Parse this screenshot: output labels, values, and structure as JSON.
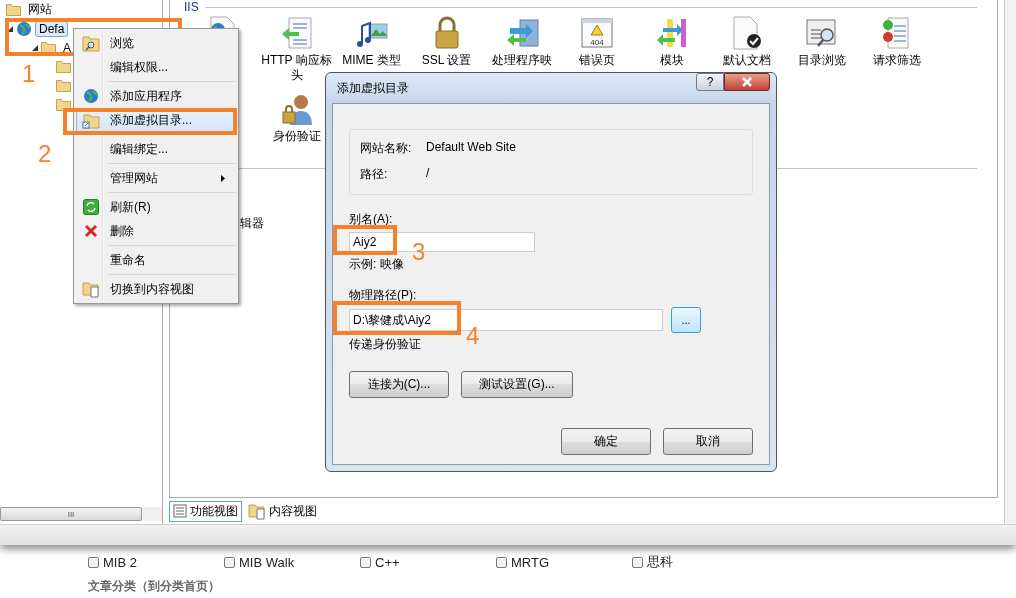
{
  "tree": {
    "root": {
      "kind": "folder",
      "label": "网站",
      "children": [
        {
          "kind": "globe",
          "label": "Defa",
          "selected": true,
          "expanded": true,
          "children": [
            {
              "kind": "folder",
              "label": "A",
              "expanded": true,
              "children": [
                {
                  "kind": "folder"
                },
                {
                  "kind": "folder"
                },
                {
                  "kind": "folder"
                }
              ]
            }
          ]
        }
      ]
    },
    "scrollbar_grip": "III"
  },
  "section_title": "IIS",
  "feature_rows": [
    {
      "items": [
        {
          "kind": "globe"
        },
        {
          "kind": "http",
          "label": "HTTP 响应标头"
        },
        {
          "kind": "mime",
          "label": "MIME 类型"
        },
        {
          "kind": "lock",
          "label": "SSL 设置"
        },
        {
          "kind": "handler",
          "label": "处理程序映"
        },
        {
          "kind": "error",
          "label": "错误页",
          "badge": "404"
        },
        {
          "kind": "module",
          "label": "模块"
        },
        {
          "kind": "doc",
          "label": "默认文档"
        },
        {
          "kind": "browse",
          "label": "目录浏览"
        },
        {
          "kind": "filter",
          "label": "请求筛选"
        }
      ]
    },
    {
      "items": [
        {
          "kind": "auth",
          "label": "身份验证"
        }
      ]
    }
  ],
  "lower_feature": "辑器",
  "view_tabs": [
    {
      "label": "功能视图",
      "selected": true
    },
    {
      "label": "内容视图",
      "selected": false
    }
  ],
  "context_menu": {
    "items": [
      {
        "kind": "browse",
        "label": "浏览",
        "selected": false
      },
      {
        "kind": "plain",
        "label": "编辑权限...",
        "selected": false
      },
      {
        "kind": "separator"
      },
      {
        "kind": "app",
        "label": "添加应用程序",
        "selected": false
      },
      {
        "kind": "vdir",
        "label": "添加虚拟目录...",
        "selected": true
      },
      {
        "kind": "separator"
      },
      {
        "kind": "plain",
        "label": "编辑绑定...",
        "selected": false
      },
      {
        "kind": "separator"
      },
      {
        "kind": "plain",
        "label": "管理网站",
        "submenu": true,
        "selected": false
      },
      {
        "kind": "separator"
      },
      {
        "kind": "refresh",
        "label": "刷新(R)",
        "selected": false
      },
      {
        "kind": "delete",
        "label": "删除",
        "selected": false
      },
      {
        "kind": "separator"
      },
      {
        "kind": "plain",
        "label": "重命名",
        "selected": false
      },
      {
        "kind": "separator"
      },
      {
        "kind": "content",
        "label": "切换到内容视图",
        "selected": false
      }
    ]
  },
  "dialog": {
    "title": "添加虚拟目录",
    "help": "?",
    "site_label": "网站名称:",
    "site_value": "Default Web Site",
    "path_label": "路径:",
    "path_value": "/",
    "alias_label": "别名(A):",
    "alias_value": "Aiy2",
    "example": "示例: 映像",
    "physical_label": "物理路径(P):",
    "physical_value": "D:\\黎健成\\Aiy2",
    "browse": "...",
    "pass_through": "传递身份验证",
    "connect_as": "连接为(C)...",
    "test_settings": "测试设置(G)...",
    "ok": "确定",
    "cancel": "取消"
  },
  "annotations": [
    {
      "number": "1"
    },
    {
      "number": "2"
    },
    {
      "number": "3"
    },
    {
      "number": "4"
    }
  ],
  "background_page": {
    "checkboxes": [
      {
        "label": "MIB 2",
        "checked": false
      },
      {
        "label": "MIB Walk",
        "checked": false
      },
      {
        "label": "C++",
        "checked": false
      },
      {
        "label": "MRTG",
        "checked": false
      },
      {
        "label": "思科",
        "checked": false
      }
    ],
    "heading": "文章分类（到分类首页）"
  }
}
